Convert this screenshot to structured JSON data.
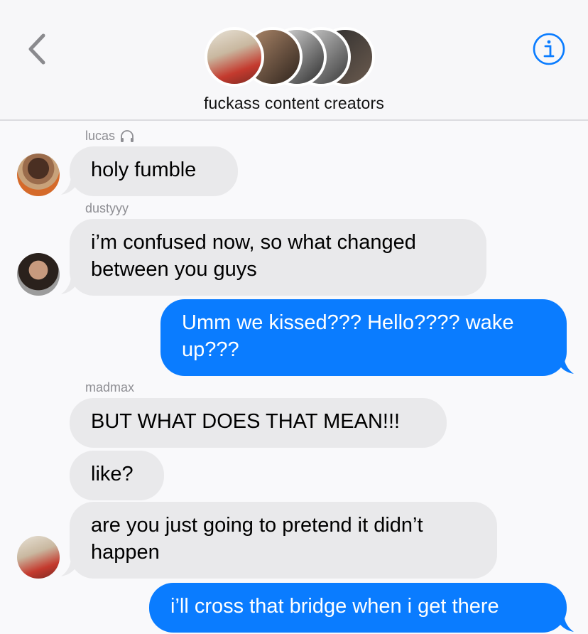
{
  "header": {
    "group_name": "fuckass content creators",
    "back_icon": "chevron-left-icon",
    "info_icon": "info-icon",
    "accent_color": "#0a7cff"
  },
  "messages": [
    {
      "sender": "lucas",
      "sender_icon": "airpods-icon",
      "text": "holy fumble",
      "direction": "incoming"
    },
    {
      "sender": "dustyyy",
      "text": "i’m confused now, so what changed between you guys",
      "direction": "incoming"
    },
    {
      "text": "Umm we kissed??? Hello???? wake up???",
      "direction": "outgoing"
    },
    {
      "sender": "madmax",
      "text": "BUT WHAT DOES THAT MEAN!!!",
      "direction": "incoming"
    },
    {
      "text": "like?",
      "direction": "incoming"
    },
    {
      "text": "are you just going to pretend it didn’t happen",
      "direction": "incoming"
    },
    {
      "text": "i’ll cross that bridge when i get there",
      "direction": "outgoing"
    }
  ]
}
